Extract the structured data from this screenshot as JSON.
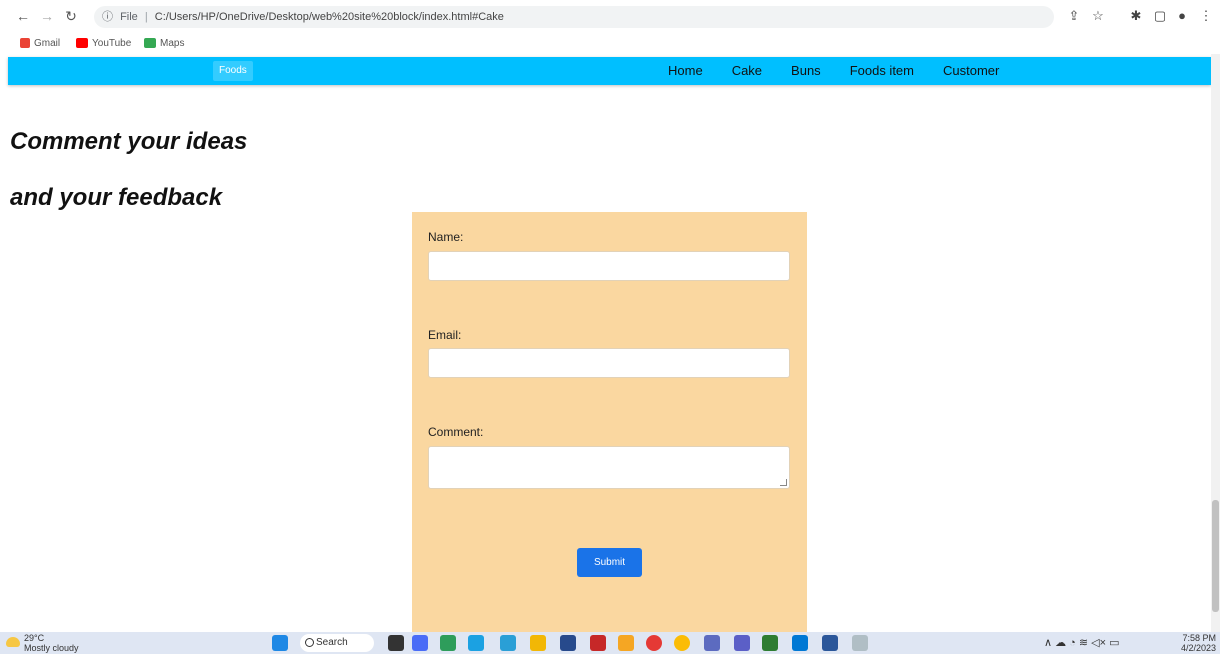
{
  "browser": {
    "url_prefix": "File",
    "url": "C:/Users/HP/OneDrive/Desktop/web%20site%20block/index.html#Cake",
    "bookmarks": [
      {
        "label": "Gmail",
        "color": "#ea4335"
      },
      {
        "label": "YouTube",
        "color": "#ff0000"
      },
      {
        "label": "Maps",
        "color": "#34a853"
      }
    ]
  },
  "site": {
    "logo": "Foods",
    "menu": [
      "Home",
      "Cake",
      "Buns",
      "Foods item",
      "Customer"
    ],
    "heading_line1": "Comment your ideas",
    "heading_line2": "and your feedback",
    "form": {
      "name_label": "Name:",
      "email_label": "Email:",
      "comment_label": "Comment:",
      "submit_label": "Submit"
    }
  },
  "taskbar": {
    "temperature": "29°C",
    "weather": "Mostly cloudy",
    "search_label": "Search",
    "time": "7:58 PM",
    "date": "4/2/2023"
  },
  "colors": {
    "nav_bar": "#00bfff",
    "form_bg": "#fad7a0",
    "submit": "#1a73e8"
  }
}
